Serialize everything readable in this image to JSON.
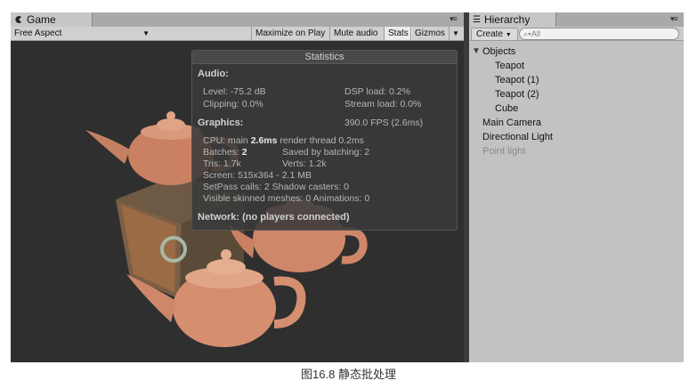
{
  "game": {
    "tab_label": "Game",
    "aspect": "Free Aspect",
    "toolbar": {
      "maximize": "Maximize on Play",
      "mute": "Mute audio",
      "stats": "Stats",
      "gizmos": "Gizmos"
    },
    "stats": {
      "title": "Statistics",
      "audio_header": "Audio:",
      "level": "Level: -75.2 dB",
      "dsp_load": "DSP load: 0.2%",
      "clipping": "Clipping: 0.0%",
      "stream_load": "Stream load: 0.0%",
      "graphics_header": "Graphics:",
      "fps": "390.0 FPS (2.6ms)",
      "cpu_prefix": "CPU: main ",
      "cpu_main": "2.6ms",
      "cpu_render": "  render thread 0.2ms",
      "batches_prefix": "Batches: ",
      "batches": "2",
      "saved_batching": "Saved by batching: 2",
      "tris": "Tris: 1.7k",
      "verts": "Verts: 1.2k",
      "screen": "Screen: 515x364 - 2.1 MB",
      "setpass": "SetPass calls: 2   Shadow casters: 0",
      "skinned": "Visible skinned meshes: 0  Animations: 0",
      "network": "Network: (no players connected)"
    }
  },
  "hierarchy": {
    "tab_label": "Hierarchy",
    "create": "Create",
    "search_placeholder": "All",
    "items": [
      {
        "label": "Objects"
      },
      {
        "label": "Teapot"
      },
      {
        "label": "Teapot (1)"
      },
      {
        "label": "Teapot (2)"
      },
      {
        "label": "Cube"
      },
      {
        "label": "Main Camera"
      },
      {
        "label": "Directional Light"
      },
      {
        "label": "Point light"
      }
    ]
  },
  "caption": "图16.8 静态批处理",
  "colors": {
    "viewport_bg": "#2f2f2f",
    "teapot": "#d98c6e",
    "cube": "#8a6a4a"
  }
}
